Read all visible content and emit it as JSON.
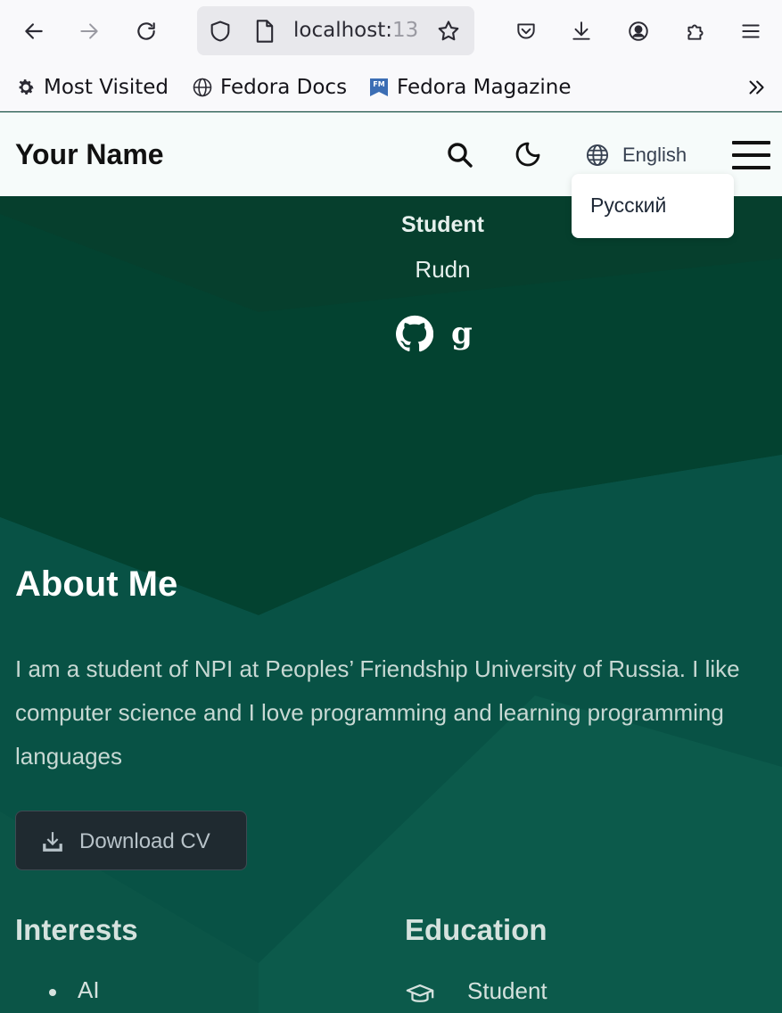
{
  "browser": {
    "url_host": "localhost:",
    "url_port_fragment": "13",
    "bookmarks": [
      {
        "label": "Most Visited",
        "icon": "gear-icon"
      },
      {
        "label": "Fedora Docs",
        "icon": "globe-icon"
      },
      {
        "label": "Fedora Magazine",
        "icon": "fedora-magazine-icon"
      }
    ],
    "overflow_label": "»"
  },
  "header": {
    "site_title": "Your Name",
    "language_current": "English",
    "language_options": [
      "Русский"
    ]
  },
  "profile": {
    "role": "Student",
    "organization": "Rudn",
    "social": [
      "github-icon",
      "google-scholar-icon"
    ],
    "scholar_glyph": "g"
  },
  "about": {
    "title": "About Me",
    "text": "I am a student of NPI at Peoples’ Friendship University of Russia. I like computer science and I love programming and learning programming languages",
    "download_label": "Download CV"
  },
  "interests": {
    "title": "Interests",
    "items": [
      "AI"
    ]
  },
  "education": {
    "title": "Education",
    "items": [
      "Student"
    ]
  },
  "colors": {
    "header_bg": "#f6fbfa",
    "hero_dark": "#03412f",
    "hero_mid": "#0b5547",
    "button_bg": "#1f2a30"
  }
}
